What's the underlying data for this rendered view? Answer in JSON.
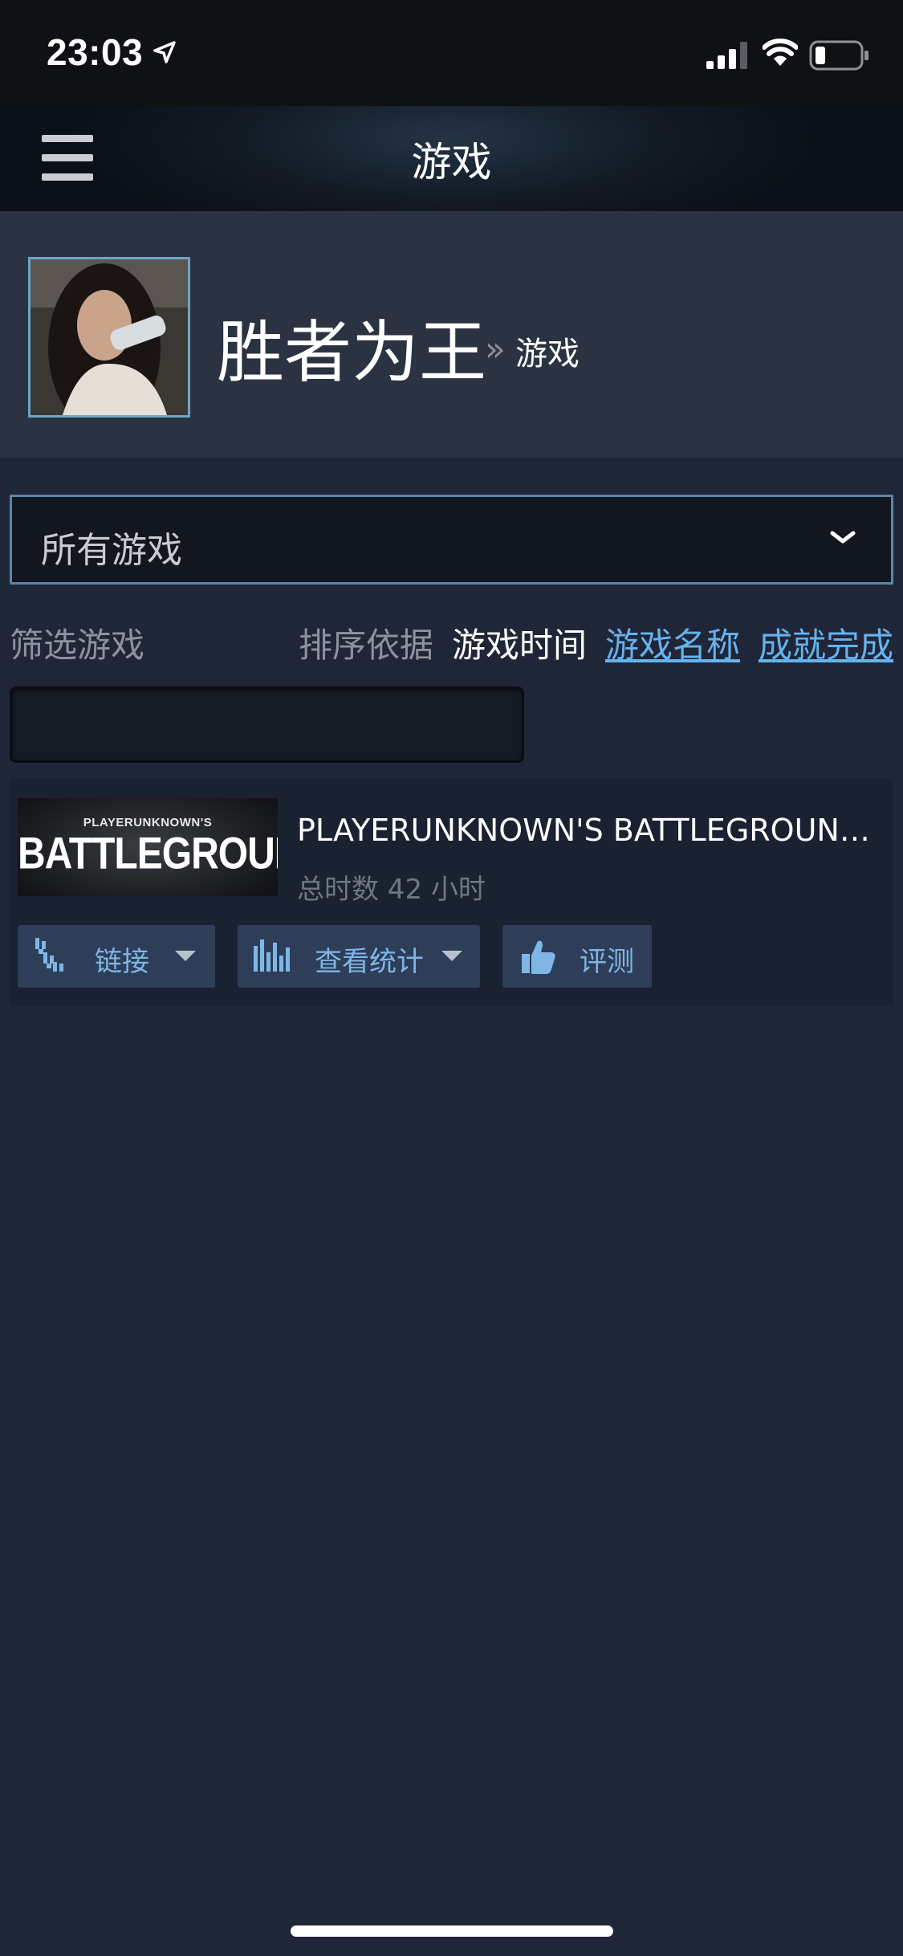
{
  "status_bar": {
    "time": "23:03",
    "icons": [
      "location-arrow-icon",
      "signal-icon",
      "wifi-icon",
      "battery-icon"
    ]
  },
  "header": {
    "title": "游戏",
    "menu_icon": "hamburger-menu-icon"
  },
  "profile": {
    "name": "胜者为王",
    "breadcrumb_separator": "»",
    "breadcrumb_current": "游戏"
  },
  "games_dropdown": {
    "selected": "所有游戏"
  },
  "filter": {
    "label": "筛选游戏",
    "value": ""
  },
  "sort": {
    "label": "排序依据",
    "active": "游戏时间",
    "options": [
      "游戏名称",
      "成就完成"
    ]
  },
  "games": [
    {
      "thumb_small": "PLAYERUNKNOWN'S",
      "thumb_big": "BATTLEGROUNDS",
      "title": "PLAYERUNKNOWN'S BATTLEGROUNDS",
      "hours": "总时数 42 小时",
      "actions": {
        "links": "链接",
        "stats": "查看统计",
        "review": "评测"
      }
    }
  ],
  "colors": {
    "background": "#1f2637",
    "link": "#66b2ee",
    "button": "#2e3e58",
    "button_text": "#7eb6e6"
  }
}
